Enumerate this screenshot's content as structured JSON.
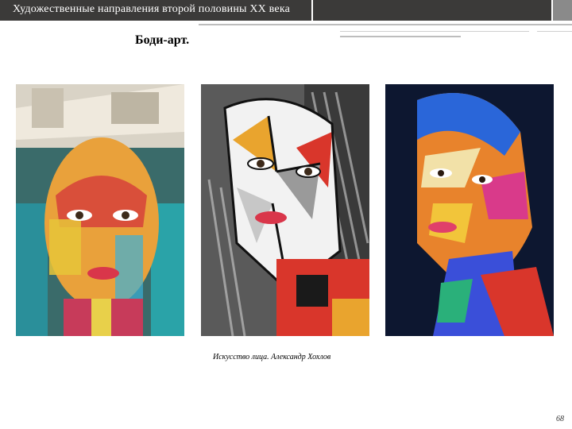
{
  "header": {
    "title": "Художественные направления второй половины XX века"
  },
  "slide": {
    "title": "Боди-арт.",
    "caption": "Искусство лица. Александр Хохлов",
    "page_number": "68"
  },
  "photos": [
    {
      "subject": "woman with multicolor face paint and newspaper hat"
    },
    {
      "subject": "woman with geometric black-white-red face paint"
    },
    {
      "subject": "woman with rainbow brush-stroke face paint"
    }
  ],
  "colors": {
    "header_bg": "#3b3a39",
    "header_text": "#ffffff",
    "accent_gray": "#8a8a8a"
  }
}
